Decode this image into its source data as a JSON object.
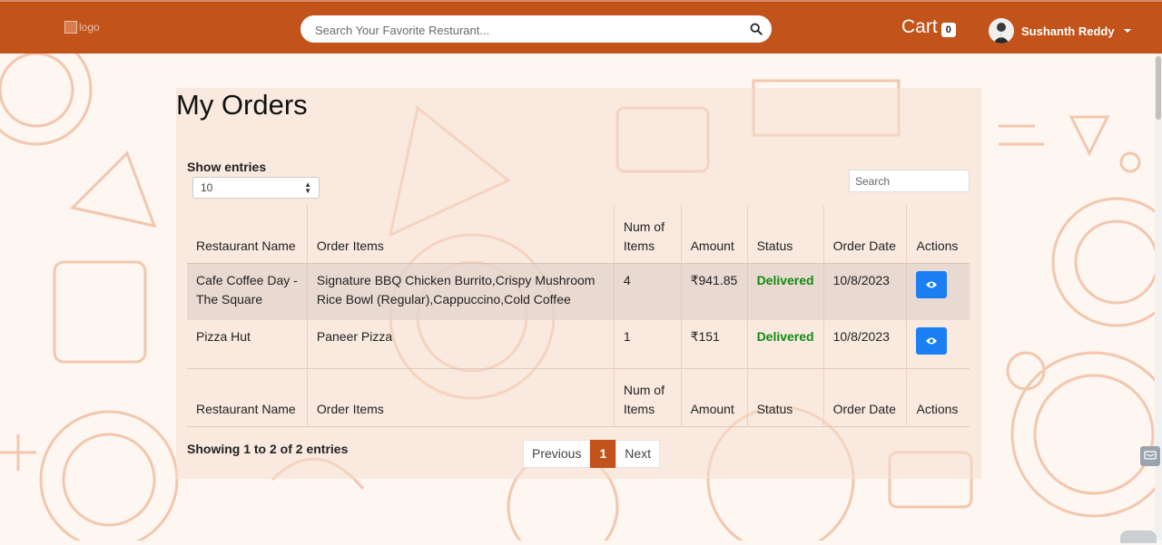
{
  "header": {
    "logo_alt": "logo",
    "search_placeholder": "Search Your Favorite Resturant...",
    "cart_label": "Cart",
    "cart_count": "0",
    "user_name": "Sushanth Reddy"
  },
  "page": {
    "title": "My Orders",
    "show_entries_label": "Show entries",
    "entries_value": "10",
    "table_search_placeholder": "Search"
  },
  "table": {
    "columns": {
      "restaurant": "Restaurant Name",
      "items": "Order Items",
      "num": "Num of Items",
      "amount": "Amount",
      "status": "Status",
      "date": "Order Date",
      "actions": "Actions"
    },
    "rows": [
      {
        "restaurant": "Cafe Coffee Day - The Square",
        "items": "Signature BBQ Chicken Burrito,Crispy Mushroom Rice Bowl (Regular),Cappuccino,Cold Coffee",
        "num": "4",
        "amount": "₹941.85",
        "status": "Delivered",
        "date": "10/8/2023"
      },
      {
        "restaurant": "Pizza Hut",
        "items": "Paneer Pizza",
        "num": "1",
        "amount": "₹151",
        "status": "Delivered",
        "date": "10/8/2023"
      }
    ]
  },
  "footer": {
    "info": "Showing 1 to 2 of 2 entries",
    "prev": "Previous",
    "page": "1",
    "next": "Next"
  },
  "colors": {
    "brand": "#c2531b",
    "status_delivered": "#118a11",
    "action_button": "#1a7ff5"
  },
  "icons": {
    "search": "search-icon",
    "view": "eye-icon",
    "dropdown": "caret-down-icon"
  }
}
